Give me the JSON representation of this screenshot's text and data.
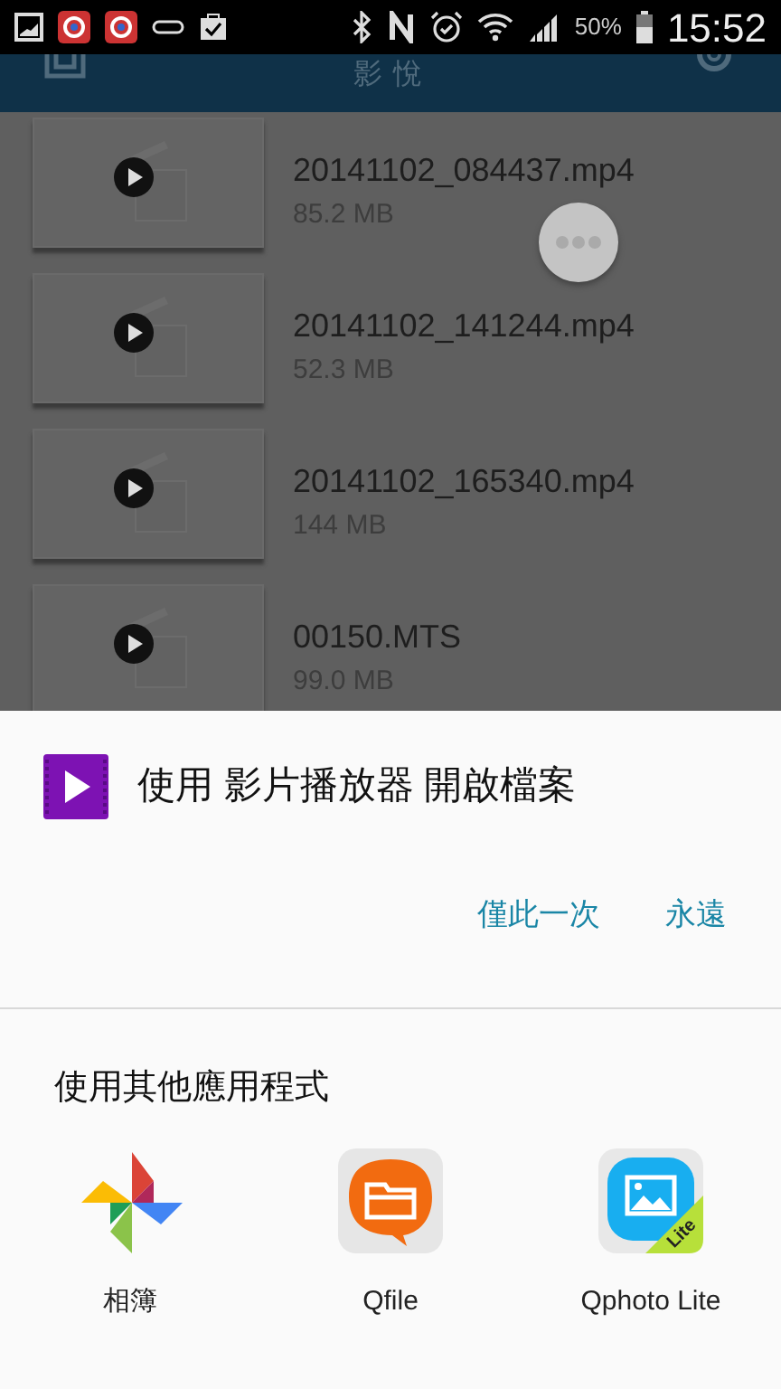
{
  "status_bar": {
    "battery": "50%",
    "time": "15:52"
  },
  "app_bar": {
    "title": "影 悅"
  },
  "files": [
    {
      "name": "20141102_084437.mp4",
      "size": "85.2 MB"
    },
    {
      "name": "20141102_141244.mp4",
      "size": "52.3 MB"
    },
    {
      "name": "20141102_165340.mp4",
      "size": "144 MB"
    },
    {
      "name": "00150.MTS",
      "size": "99.0 MB"
    }
  ],
  "dialog": {
    "title": "使用 影片播放器 開啟檔案",
    "buttons": [
      "僅此一次",
      "永遠"
    ],
    "other_heading": "使用其他應用程式",
    "apps": [
      {
        "kind": "photos",
        "label": "相簿"
      },
      {
        "kind": "qfile",
        "label": "Qfile"
      },
      {
        "kind": "qphoto",
        "label": "Qphoto Lite",
        "badge": "Lite"
      }
    ]
  }
}
